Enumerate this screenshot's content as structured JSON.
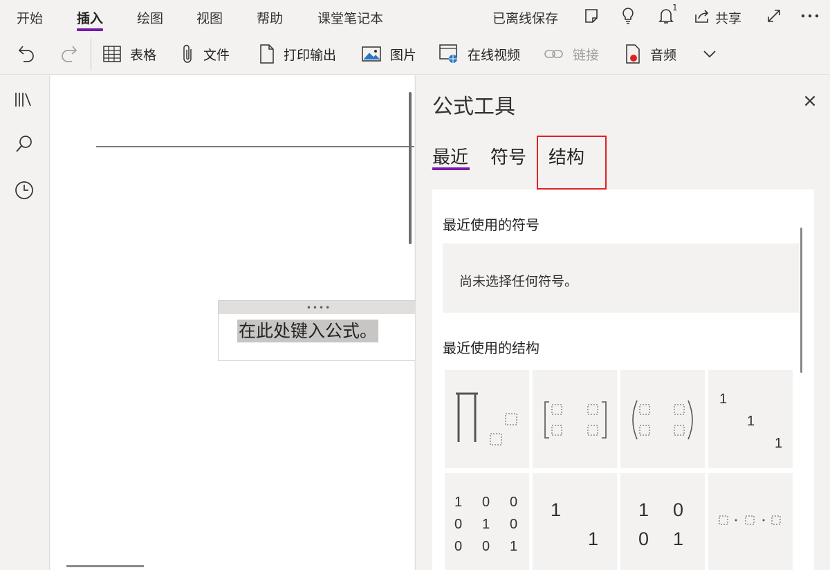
{
  "menu": {
    "tabs": [
      "开始",
      "插入",
      "绘图",
      "视图",
      "帮助",
      "课堂笔记本"
    ],
    "active_tab": "插入",
    "save_status": "已离线保存",
    "notification_count": "1",
    "share_label": "共享"
  },
  "ribbon": {
    "table": "表格",
    "file": "文件",
    "printout": "打印输出",
    "picture": "图片",
    "online_video": "在线视频",
    "link": "链接",
    "audio": "音频"
  },
  "canvas": {
    "equation_placeholder": "在此处键入公式。",
    "handle": "••••"
  },
  "pane": {
    "title": "公式工具",
    "close": "×",
    "tabs": [
      "最近",
      "符号",
      "结构"
    ],
    "active_tab": "最近",
    "highlighted_tab": "结构",
    "recent_symbols_title": "最近使用的符号",
    "recent_symbols_empty": "尚未选择任何符号。",
    "recent_structures_title": "最近使用的结构",
    "structures": [
      {
        "name": "product-operator"
      },
      {
        "name": "matrix-2x2-brackets"
      },
      {
        "name": "matrix-2x2-parens"
      },
      {
        "name": "identity-diagonal-3",
        "cells": [
          "1",
          "1",
          "1"
        ]
      },
      {
        "name": "identity-matrix-3x3",
        "cells": [
          "1",
          "0",
          "0",
          "0",
          "1",
          "0",
          "0",
          "0",
          "1"
        ]
      },
      {
        "name": "identity-diagonal-2",
        "cells": [
          "1",
          "1"
        ]
      },
      {
        "name": "identity-matrix-2x2",
        "cells": [
          "1",
          "0",
          "0",
          "1"
        ]
      },
      {
        "name": "matrix-dots"
      }
    ]
  },
  "colors": {
    "accent": "#7719aa",
    "annotation_red": "#e02020"
  }
}
